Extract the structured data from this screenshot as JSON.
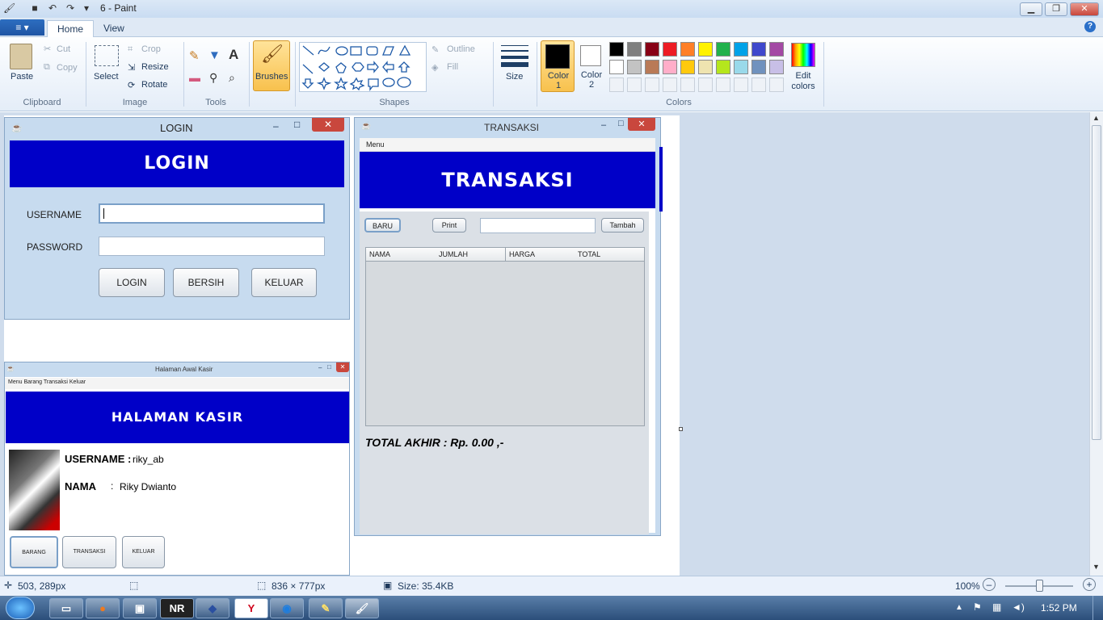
{
  "window": {
    "title": "6 - Paint",
    "minimize": "▁",
    "maximize": "❐",
    "close": "✕"
  },
  "quick_access": {
    "save_icon": "floppy",
    "undo_icon": "undo",
    "redo_icon": "redo",
    "dropdown_icon": "▾"
  },
  "menu": {
    "file_label": "≡ ▾",
    "tabs": [
      {
        "label": "Home"
      },
      {
        "label": "View"
      }
    ],
    "help": "?"
  },
  "ribbon": {
    "clipboard": {
      "paste": "Paste",
      "cut": "Cut",
      "copy": "Copy",
      "label": "Clipboard"
    },
    "image": {
      "select": "Select",
      "crop": "Crop",
      "resize": "Resize",
      "rotate": "Rotate",
      "label": "Image"
    },
    "tools": {
      "label": "Tools"
    },
    "brushes": {
      "label": "Brushes"
    },
    "shapes": {
      "outline": "Outline",
      "fill": "Fill",
      "label": "Shapes"
    },
    "size": {
      "label": "Size"
    },
    "colors": {
      "color1": "Color 1",
      "color2": "Color 2",
      "edit": "Edit colors",
      "label": "Colors",
      "color1_value": "#000000",
      "color2_value": "#ffffff",
      "row1": [
        "#000000",
        "#7f7f7f",
        "#880015",
        "#ed1c24",
        "#ff7f27",
        "#fff200",
        "#22b14c",
        "#00a2e8",
        "#3f48cc",
        "#a349a4"
      ],
      "row2": [
        "#ffffff",
        "#c3c3c3",
        "#b97a57",
        "#ffaec9",
        "#ffc90e",
        "#efe4b0",
        "#b5e61d",
        "#99d9ea",
        "#7092be",
        "#c8bfe7"
      ]
    }
  },
  "login": {
    "title": "LOGIN",
    "banner": "LOGIN",
    "username_label": "USERNAME",
    "password_label": "PASSWORD",
    "btn_login": "LOGIN",
    "btn_clear": "BERSIH",
    "btn_exit": "KELUAR"
  },
  "transaksi": {
    "title": "TRANSAKSI",
    "menu": "Menu",
    "banner": "TRANSAKSI",
    "btn_new": "BARU",
    "btn_print": "Print",
    "btn_add": "Tambah",
    "columns": [
      "NAMA",
      "JUMLAH",
      "HARGA",
      "TOTAL"
    ],
    "total": "TOTAL AKHIR : Rp. 0.00 ,-"
  },
  "kasir": {
    "title": "Halaman Awal Kasir",
    "menu": "Menu  Barang  Transaksi  Keluar",
    "banner": "HALAMAN KASIR",
    "username_label": "USERNAME :",
    "username_value": "riky_ab",
    "name_label": "NAMA",
    "name_sep": ":",
    "name_value": "Riky Dwianto",
    "btn1": "BARANG",
    "btn2": "TRANSAKSI",
    "btn3": "KELUAR"
  },
  "status": {
    "cursor": "503, 289px",
    "size_dims": "836 × 777px",
    "file_size": "Size: 35.4KB",
    "zoom": "100%"
  },
  "taskbar": {
    "clock": "1:52 PM"
  }
}
